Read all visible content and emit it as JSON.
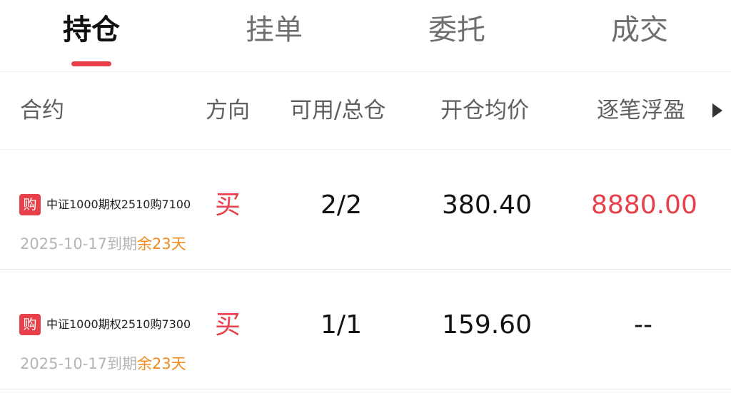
{
  "tabs": [
    {
      "label": "持仓",
      "active": true
    },
    {
      "label": "挂单",
      "active": false
    },
    {
      "label": "委托",
      "active": false
    },
    {
      "label": "成交",
      "active": false
    }
  ],
  "columns": {
    "contract": "合约",
    "direction": "方向",
    "available_total": "可用/总仓",
    "open_avg_price": "开仓均价",
    "floating_pnl": "逐笔浮盈"
  },
  "positions": [
    {
      "badge": "购",
      "name": "中证1000期权2510购7100",
      "expiry": "2025-10-17到期",
      "days_left": "余23天",
      "direction": "买",
      "available_total": "2/2",
      "open_avg_price": "380.40",
      "floating_pnl": "8880.00"
    },
    {
      "badge": "购",
      "name": "中证1000期权2510购7300",
      "expiry": "2025-10-17到期",
      "days_left": "余23天",
      "direction": "买",
      "available_total": "1/1",
      "open_avg_price": "159.60",
      "floating_pnl": "--"
    }
  ],
  "colors": {
    "accent_red": "#e8404a",
    "days_left_orange": "#f08a1c",
    "muted_gray": "#b4b4b4"
  },
  "icons": {
    "scroll_columns": "triangle-right-icon"
  }
}
